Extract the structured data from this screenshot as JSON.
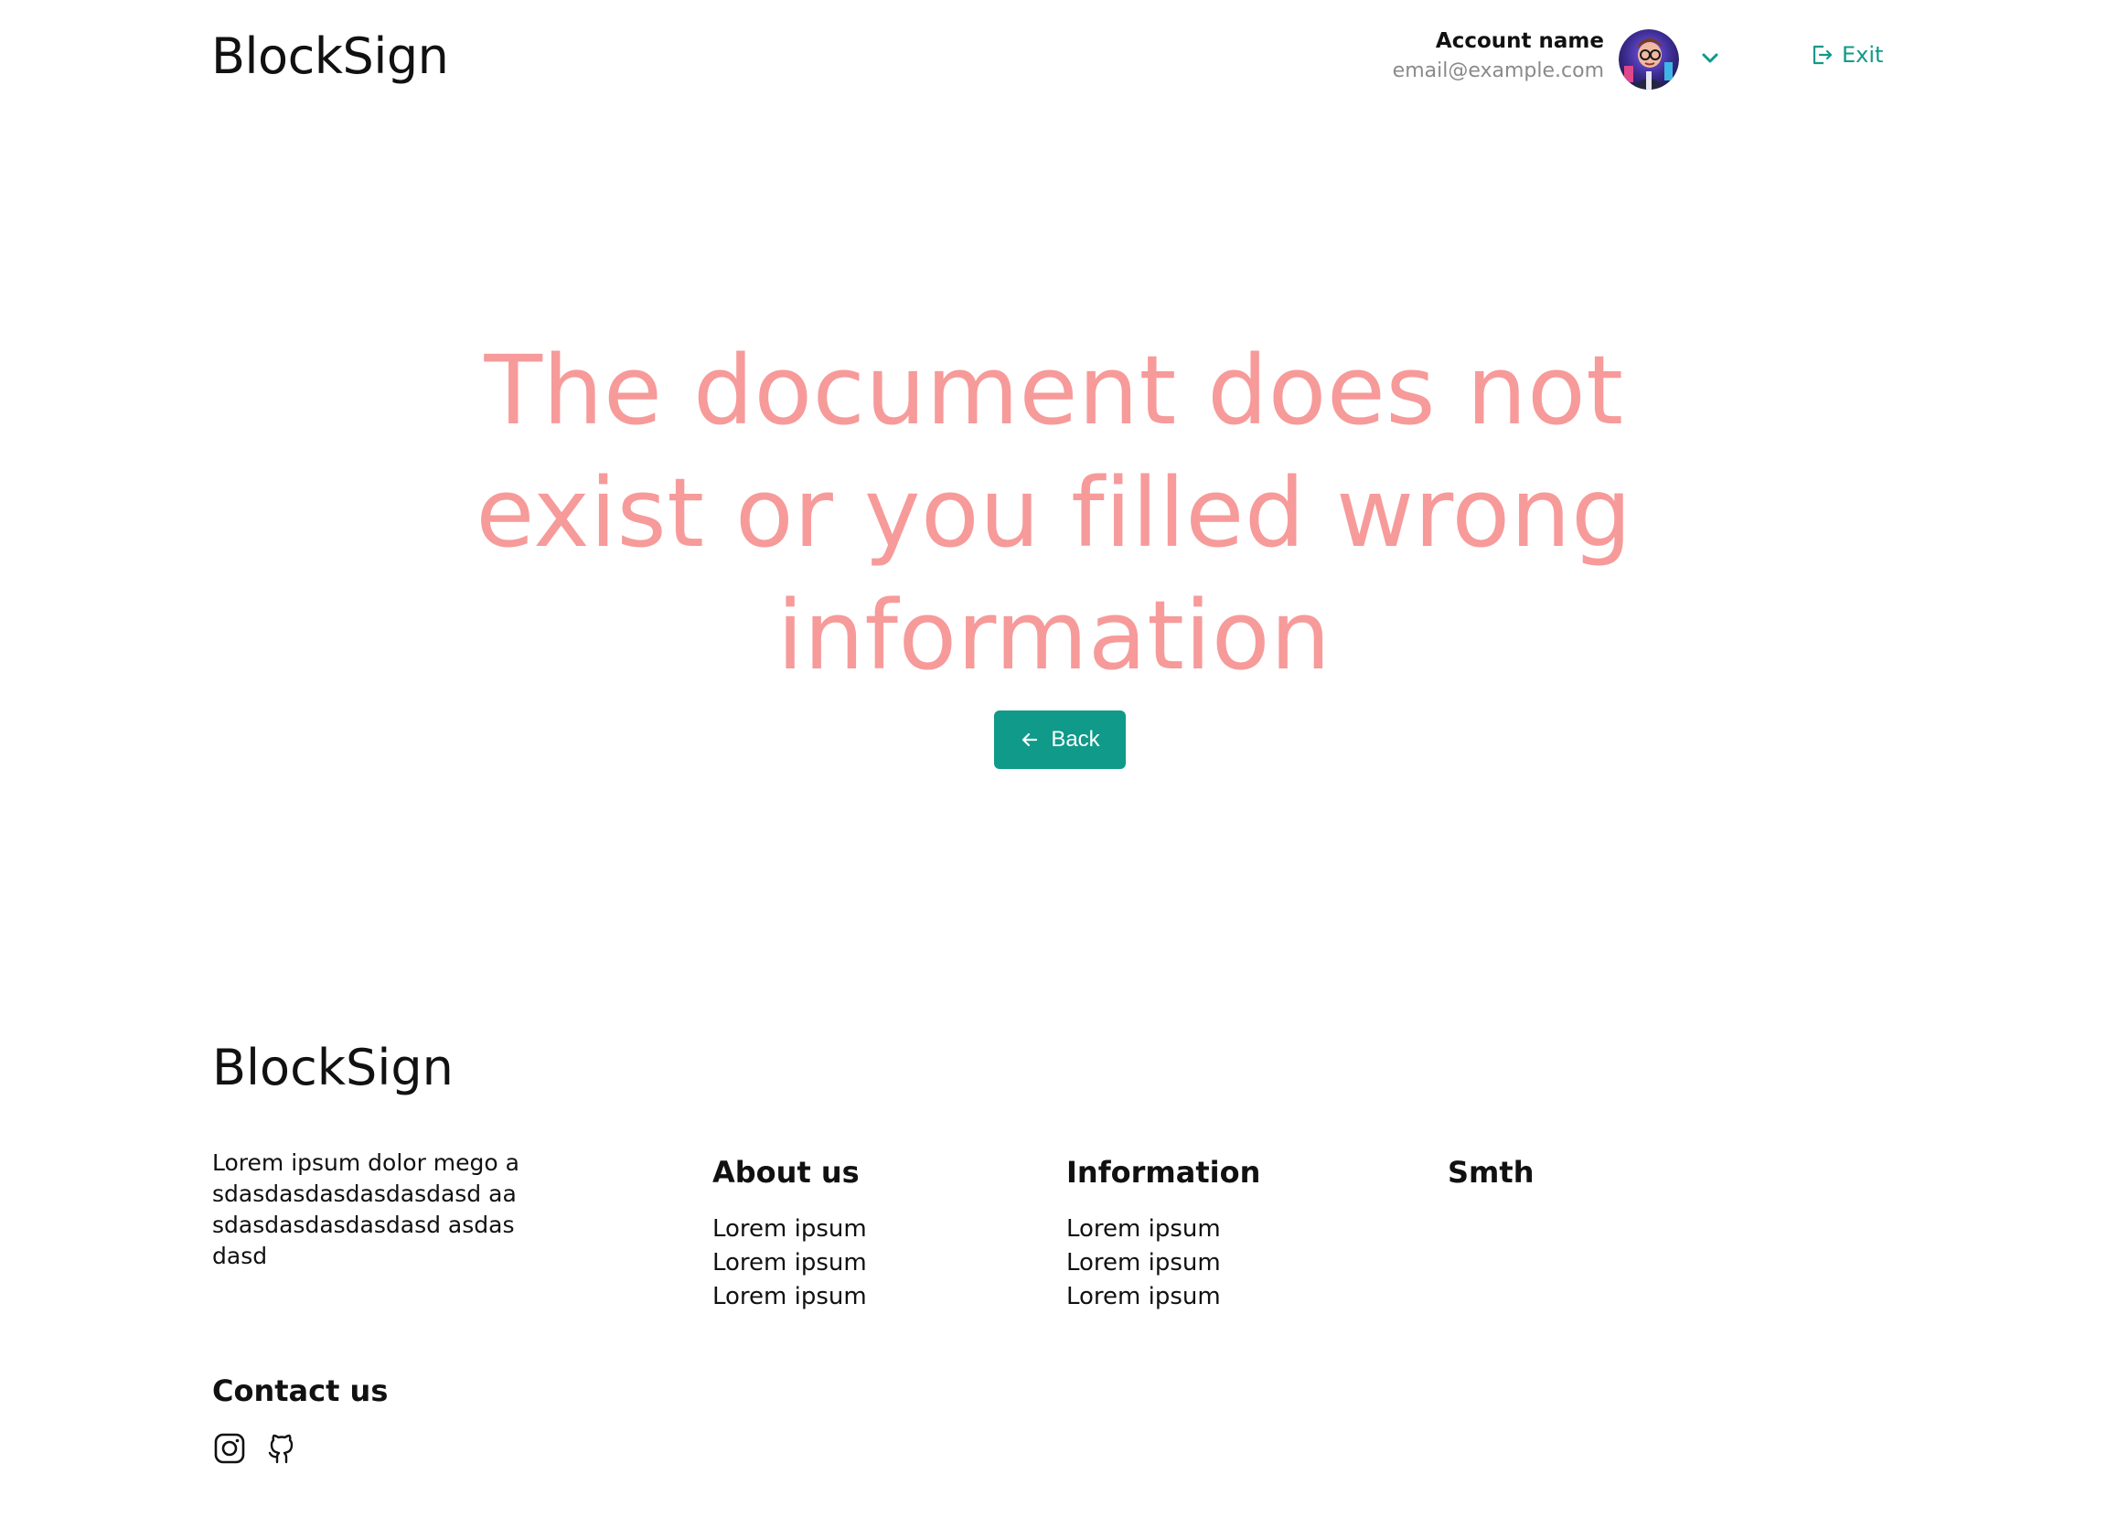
{
  "header": {
    "logo": "BlockSign",
    "account_name": "Account name",
    "account_email": "email@example.com",
    "exit_label": "Exit",
    "accent_color": "#0f9a8a"
  },
  "main": {
    "message": "The document does not exist or you filled wrong information",
    "message_color": "#f79a9a",
    "back_label": "Back"
  },
  "footer": {
    "logo": "BlockSign",
    "description": "Lorem ipsum dolor mego asdasdasdasdasdasdasd aasdasdasdasdasdasd asdasdasd",
    "columns": [
      {
        "title": "About us",
        "links": [
          "Lorem ipsum",
          "Lorem ipsum",
          "Lorem ipsum"
        ]
      },
      {
        "title": "Information",
        "links": [
          "Lorem ipsum",
          "Lorem ipsum",
          "Lorem ipsum"
        ]
      },
      {
        "title": "Smth",
        "links": []
      }
    ],
    "contact_title": "Contact us",
    "social_icons": [
      "instagram-icon",
      "github-icon"
    ]
  }
}
